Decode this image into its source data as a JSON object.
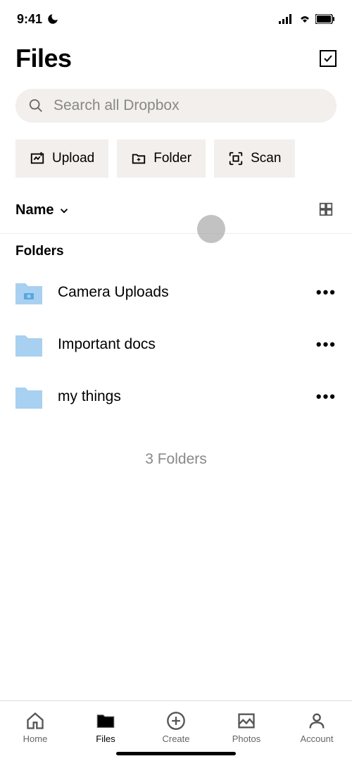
{
  "status": {
    "time": "9:41"
  },
  "header": {
    "title": "Files"
  },
  "search": {
    "placeholder": "Search all Dropbox"
  },
  "actions": {
    "upload": "Upload",
    "folder": "Folder",
    "scan": "Scan"
  },
  "sort": {
    "label": "Name"
  },
  "section": {
    "folders_label": "Folders"
  },
  "folders": [
    {
      "name": "Camera Uploads",
      "type": "camera"
    },
    {
      "name": "Important docs",
      "type": "plain"
    },
    {
      "name": "my things",
      "type": "plain"
    }
  ],
  "summary": {
    "count": "3 Folders"
  },
  "tabs": [
    {
      "label": "Home",
      "id": "home"
    },
    {
      "label": "Files",
      "id": "files",
      "active": true
    },
    {
      "label": "Create",
      "id": "create"
    },
    {
      "label": "Photos",
      "id": "photos"
    },
    {
      "label": "Account",
      "id": "account"
    }
  ]
}
